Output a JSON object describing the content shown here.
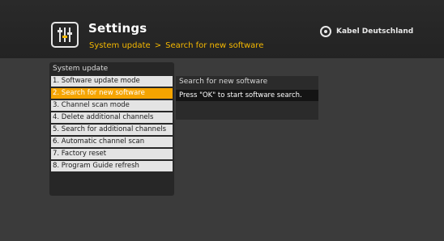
{
  "header": {
    "title": "Settings",
    "breadcrumb": [
      "System update",
      "Search for new software"
    ],
    "breadcrumb_separator": ">",
    "brand_name": "Kabel Deutschland",
    "icon": "settings-sliders-icon"
  },
  "menu": {
    "title": "System update",
    "items": [
      "1. Software update mode",
      "2. Search for new software",
      "3. Channel scan mode",
      "4. Delete additional channels",
      "5. Search for additional channels",
      "6. Automatic channel scan",
      "7. Factory reset",
      "8. Program Guide refresh"
    ],
    "selected_index": 1
  },
  "detail": {
    "title": "Search for new software",
    "message": "Press \"OK\" to start software search."
  },
  "colors": {
    "accent": "#f5a400",
    "breadcrumb": "#f5b800",
    "background": "#3b3b3b"
  }
}
